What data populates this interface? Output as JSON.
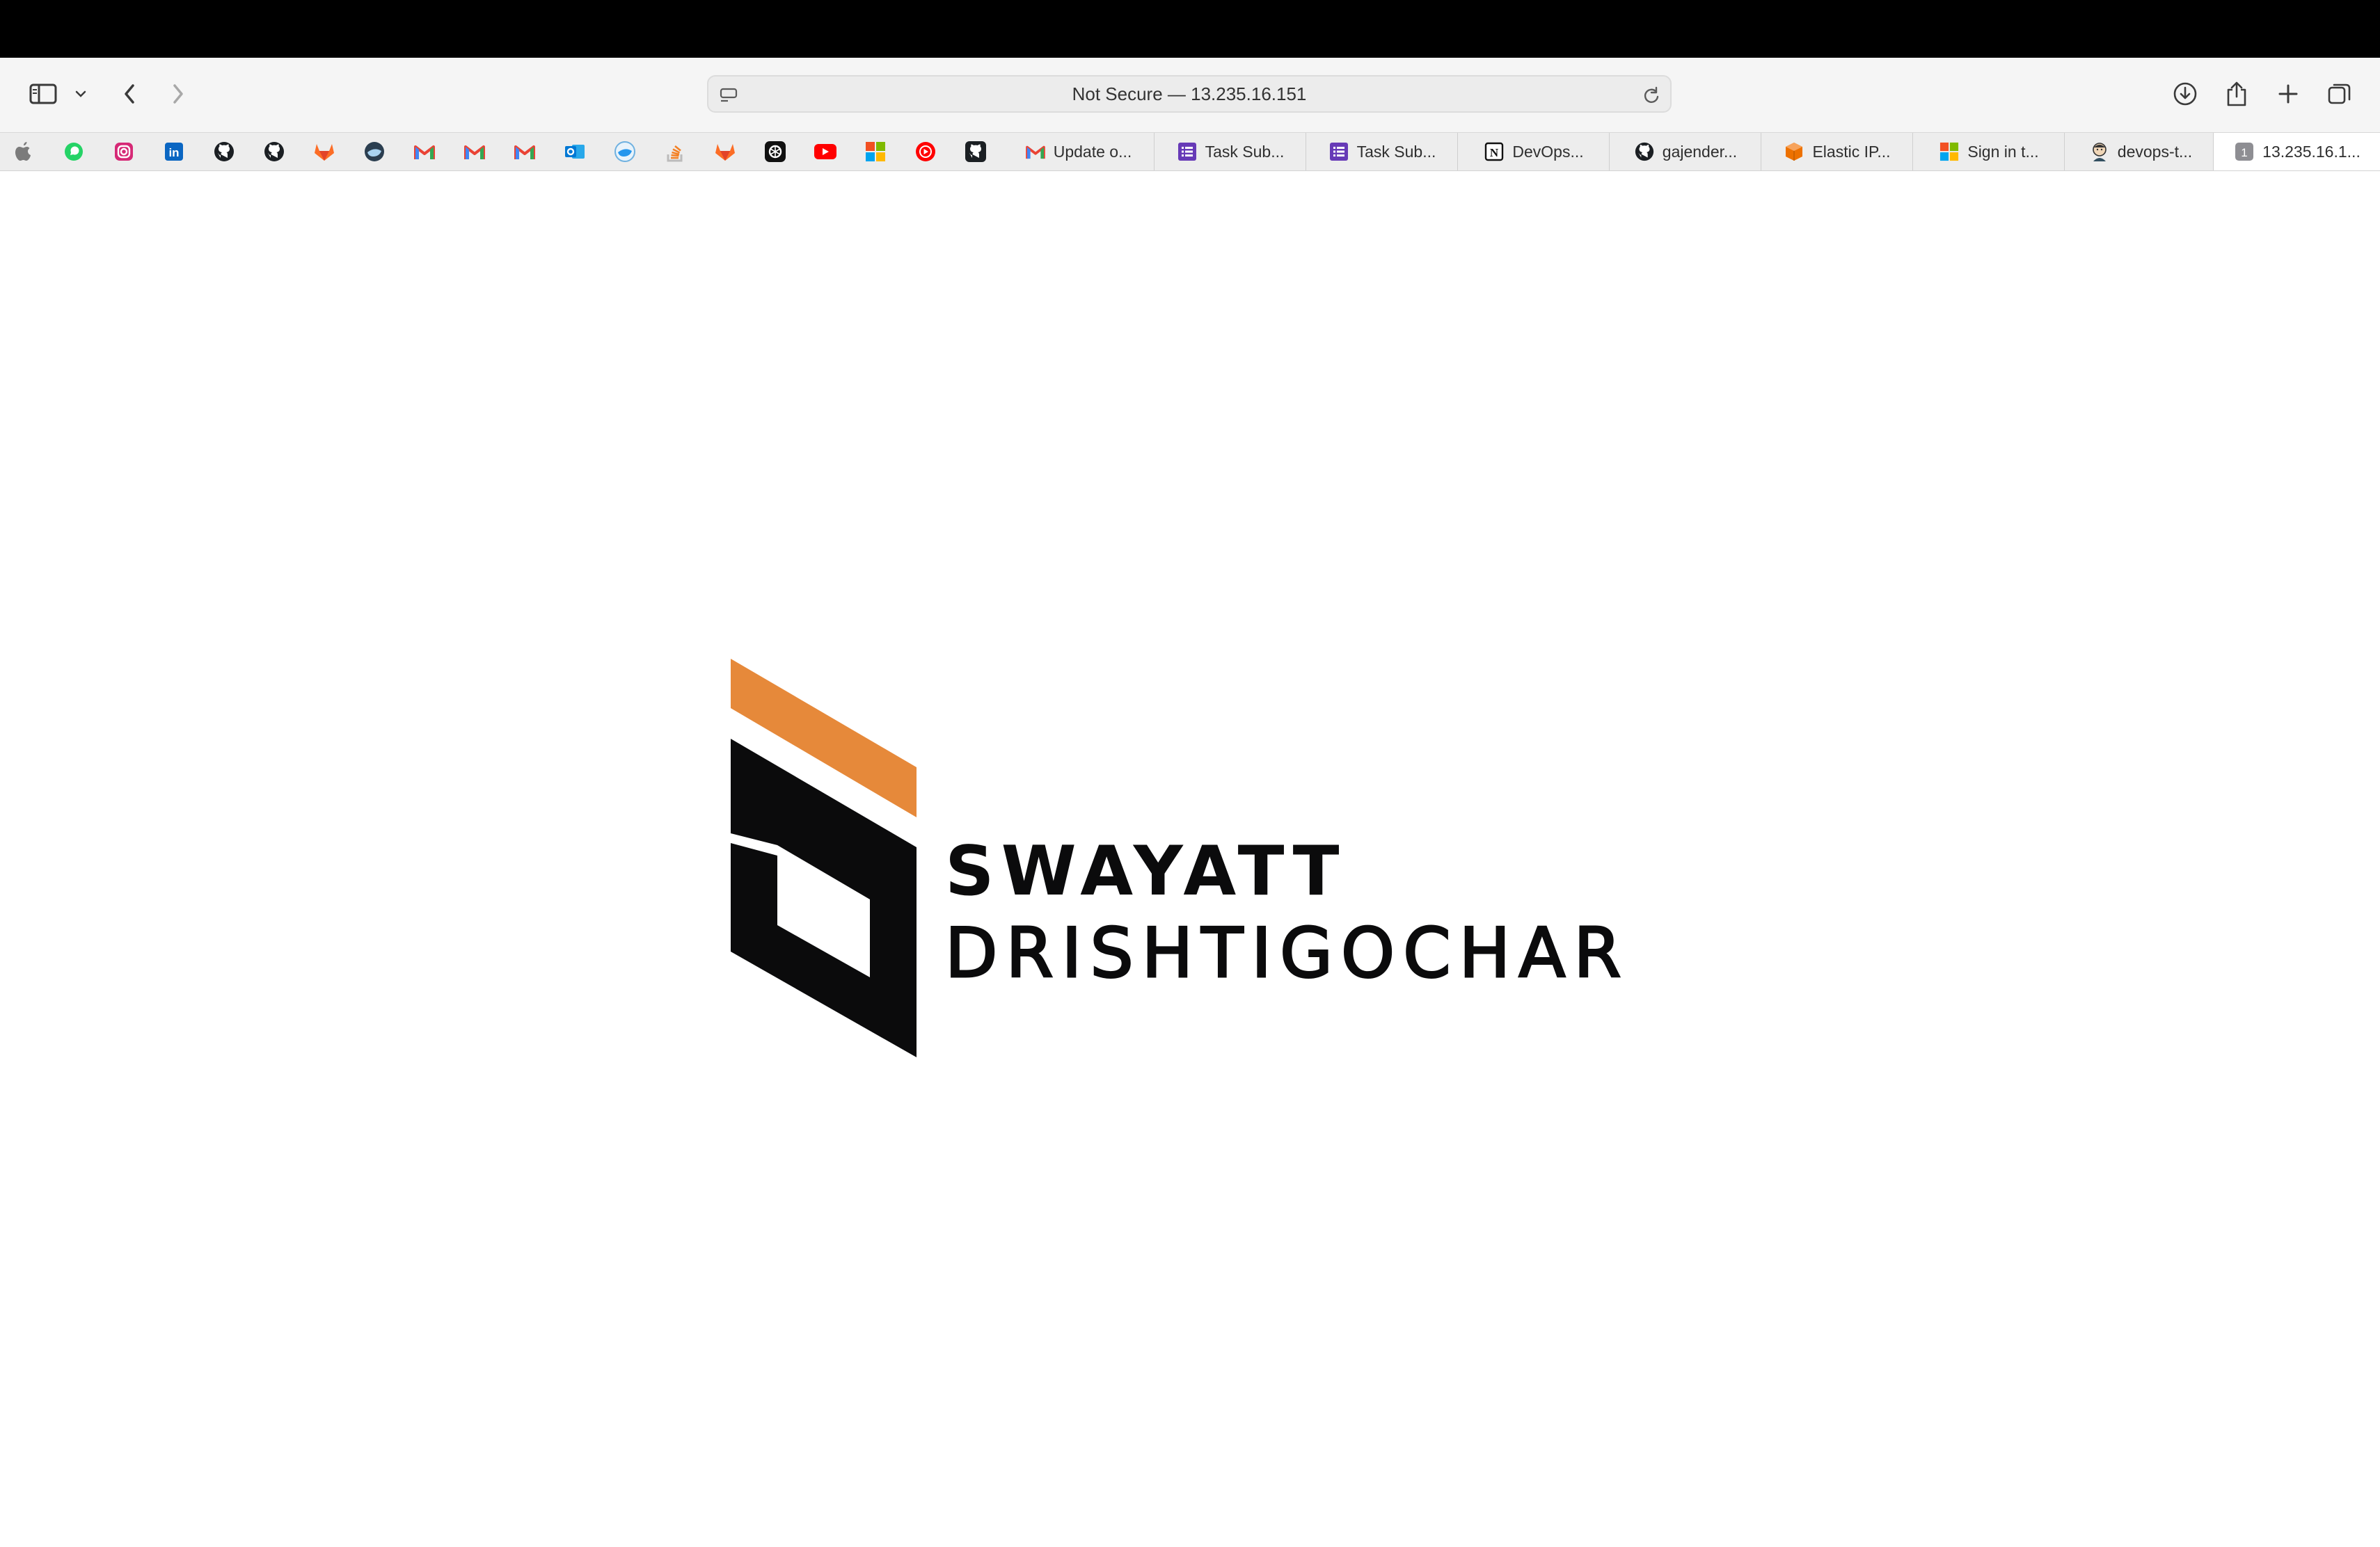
{
  "browser": {
    "address_bar": {
      "text": "Not Secure — 13.235.16.151"
    },
    "bookmarks": [
      {
        "name": "apple-bookmark",
        "icon": "apple-icon"
      },
      {
        "name": "whatsapp-bookmark",
        "icon": "whatsapp-icon",
        "color": "#25D366"
      },
      {
        "name": "instagram-bookmark",
        "icon": "instagram-icon",
        "color": "#E1306C"
      },
      {
        "name": "linkedin-bookmark",
        "icon": "linkedin-icon",
        "color": "#0A66C2"
      },
      {
        "name": "github-bookmark-1",
        "icon": "github-icon"
      },
      {
        "name": "github-bookmark-2",
        "icon": "github-icon"
      },
      {
        "name": "gitlab-bookmark-1",
        "icon": "gitlab-icon",
        "color": "#FC6D26"
      },
      {
        "name": "docker-bookmark-1",
        "icon": "docker-icon"
      },
      {
        "name": "gmail-bookmark-1",
        "icon": "gmail-icon"
      },
      {
        "name": "gmail-bookmark-2",
        "icon": "gmail-icon"
      },
      {
        "name": "gmail-bookmark-3",
        "icon": "gmail-icon"
      },
      {
        "name": "outlook-bookmark",
        "icon": "outlook-icon",
        "color": "#0078D4"
      },
      {
        "name": "docker-bookmark-2",
        "icon": "docker-icon"
      },
      {
        "name": "stackoverflow-bookmark",
        "icon": "stackoverflow-icon",
        "color": "#F48024"
      },
      {
        "name": "gitlab-bookmark-2",
        "icon": "gitlab-icon",
        "color": "#FC6D26"
      },
      {
        "name": "openai-bookmark",
        "icon": "openai-icon"
      },
      {
        "name": "youtube-bookmark",
        "icon": "youtube-icon",
        "color": "#FF0000"
      },
      {
        "name": "microsoft-bookmark",
        "icon": "microsoft-icon"
      },
      {
        "name": "youtube-music-bookmark",
        "icon": "youtube-music-icon",
        "color": "#FF0000"
      },
      {
        "name": "github-bookmark-3",
        "icon": "github-icon"
      }
    ],
    "labeled_bookmarks": [
      {
        "label": "Update o...",
        "icon": "gmail-icon"
      },
      {
        "label": "Task Sub...",
        "icon": "forms-icon"
      },
      {
        "label": "Task Sub...",
        "icon": "forms-icon"
      },
      {
        "label": "DevOps...",
        "icon": "notion-icon"
      },
      {
        "label": "gajender...",
        "icon": "github-icon"
      },
      {
        "label": "Elastic IP...",
        "icon": "aws-icon"
      },
      {
        "label": "Sign in t...",
        "icon": "microsoft-icon"
      },
      {
        "label": "devops-t...",
        "icon": "jenkins-icon"
      },
      {
        "label": "13.235.16.1...",
        "icon": "number-one-icon",
        "badge": "1"
      }
    ]
  },
  "page": {
    "brand_line1": "SWAYATT",
    "brand_line2": "DRISHTIGOCHAR",
    "colors": {
      "accent": "#E6893A",
      "dark": "#0B0B0C"
    }
  }
}
